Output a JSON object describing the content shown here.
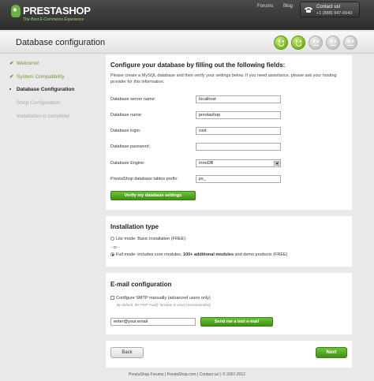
{
  "header": {
    "logo_text": "PRESTASHOP",
    "tagline": "The Best E-Commerce Experience",
    "nav": [
      "Forums",
      "Blog"
    ],
    "contact_title": "Contact us!",
    "contact_phone": "+1 (888) 947-6543"
  },
  "title": "Database configuration",
  "progress": {
    "done_steps": 2,
    "total_steps": 5
  },
  "steps": [
    {
      "label": "Welcome!",
      "state": "done"
    },
    {
      "label": "System Compatibility",
      "state": "done"
    },
    {
      "label": "Database Configuration",
      "state": "current"
    },
    {
      "label": "Shop Configuration",
      "state": "todo"
    },
    {
      "label": "Installation is complete!",
      "state": "todo"
    }
  ],
  "database": {
    "heading": "Configure your database by filling out the following fields:",
    "intro": "Please create a MySQL database and then verify your settings below. If you need assistance, please ask your hosting provider for this information.",
    "fields": [
      {
        "label": "Database server name:",
        "value": "localhost"
      },
      {
        "label": "Database name:",
        "value": "prestashop"
      },
      {
        "label": "Database login:",
        "value": "root"
      },
      {
        "label": "Database password:",
        "value": ""
      },
      {
        "label": "Database Engine:",
        "value": "InnoDB"
      },
      {
        "label": "PrestaShop database tables prefix:",
        "value": "ps_"
      }
    ],
    "verify_button": "Verify my database settings"
  },
  "installation": {
    "heading": "Installation type",
    "lite_label": "Lite mode: Basic installation (FREE)",
    "or_label": "- or -",
    "full_prefix": "Full mode: includes core modules, ",
    "full_bold": "100+ additional modules",
    "full_suffix": " and demo products (FREE)",
    "selected": "full"
  },
  "email": {
    "heading": "E-mail configuration",
    "smtp_label": "Configure SMTP manually (advanced users only)",
    "smtp_note": "By default, the PHP 'mail()' function is used (recommended)",
    "email_value": "enter@your.email",
    "send_button": "Send me a test e-mail"
  },
  "buttons": {
    "back": "Back",
    "next": "Next"
  },
  "footer": "PrestaShop Forums | PrestaShop.com | Contact us! | © 2007-2012"
}
